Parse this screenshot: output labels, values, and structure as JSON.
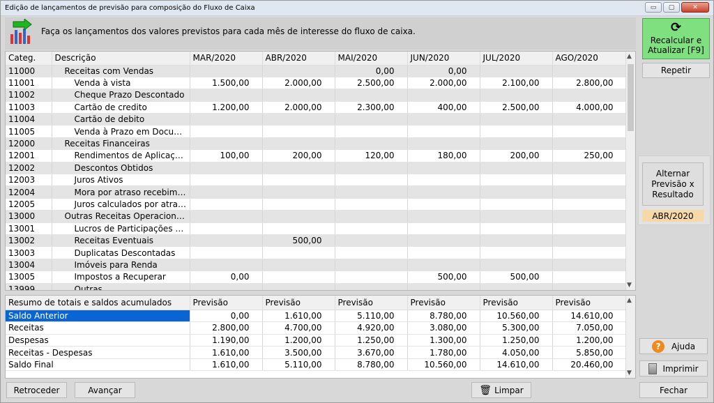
{
  "window": {
    "title": "Edição de lançamentos de previsão para composição do Fluxo de Caixa",
    "controls": {
      "minimize": "▭",
      "maximize": "▢",
      "close": "✕"
    }
  },
  "header": {
    "instruction": "Faça os lançamentos dos valores previstos para cada mês de interesse do fluxo de caixa."
  },
  "grid": {
    "columns": [
      "Categ.",
      "Descrição",
      "MAR/2020",
      "ABR/2020",
      "MAI/2020",
      "JUN/2020",
      "JUL/2020",
      "AGO/2020"
    ],
    "rows": [
      {
        "cat": "11000",
        "desc": "Receitas com Vendas",
        "level": 1,
        "group": true,
        "v": [
          "",
          "",
          "0,00",
          "0,00",
          "",
          ""
        ]
      },
      {
        "cat": "11001",
        "desc": "Venda à vista",
        "level": 2,
        "group": false,
        "v": [
          "1.500,00",
          "2.000,00",
          "2.500,00",
          "2.000,00",
          "2.100,00",
          "2.800,00"
        ]
      },
      {
        "cat": "11002",
        "desc": "Cheque Prazo Descontado",
        "level": 2,
        "group": true,
        "v": [
          "",
          "",
          "",
          "",
          "",
          ""
        ]
      },
      {
        "cat": "11003",
        "desc": "Cartão de credito",
        "level": 2,
        "group": false,
        "v": [
          "1.200,00",
          "2.000,00",
          "2.300,00",
          "400,00",
          "2.500,00",
          "4.000,00"
        ]
      },
      {
        "cat": "11004",
        "desc": "Cartão de debito",
        "level": 2,
        "group": true,
        "v": [
          "",
          "",
          "",
          "",
          "",
          ""
        ]
      },
      {
        "cat": "11005",
        "desc": "Venda à Prazo em Documentos",
        "level": 2,
        "group": false,
        "v": [
          "",
          "",
          "",
          "",
          "",
          ""
        ]
      },
      {
        "cat": "12000",
        "desc": "Receitas Financeiras",
        "level": 1,
        "group": true,
        "v": [
          "",
          "",
          "",
          "",
          "",
          ""
        ]
      },
      {
        "cat": "12001",
        "desc": "Rendimentos de Aplicações Financeiras",
        "level": 2,
        "group": false,
        "v": [
          "100,00",
          "200,00",
          "120,00",
          "180,00",
          "200,00",
          "250,00"
        ]
      },
      {
        "cat": "12002",
        "desc": "Descontos Obtidos",
        "level": 2,
        "group": true,
        "v": [
          "",
          "",
          "",
          "",
          "",
          ""
        ]
      },
      {
        "cat": "12003",
        "desc": "Juros Ativos",
        "level": 2,
        "group": false,
        "v": [
          "",
          "",
          "",
          "",
          "",
          ""
        ]
      },
      {
        "cat": "12004",
        "desc": "Mora por atraso recebimento",
        "level": 2,
        "group": true,
        "v": [
          "",
          "",
          "",
          "",
          "",
          ""
        ]
      },
      {
        "cat": "12005",
        "desc": "Juros calculados por atraso no pagamento",
        "level": 2,
        "group": false,
        "v": [
          "",
          "",
          "",
          "",
          "",
          ""
        ]
      },
      {
        "cat": "13000",
        "desc": "Outras Receitas Operacionais",
        "level": 1,
        "group": true,
        "v": [
          "",
          "",
          "",
          "",
          "",
          ""
        ]
      },
      {
        "cat": "13001",
        "desc": "Lucros de Participações em Outras Empresas",
        "level": 2,
        "group": false,
        "v": [
          "",
          "",
          "",
          "",
          "",
          ""
        ]
      },
      {
        "cat": "13002",
        "desc": "Receitas Eventuais",
        "level": 2,
        "group": true,
        "v": [
          "",
          "500,00",
          "",
          "",
          "",
          ""
        ]
      },
      {
        "cat": "13003",
        "desc": "Duplicatas Descontadas",
        "level": 2,
        "group": false,
        "v": [
          "",
          "",
          "",
          "",
          "",
          ""
        ]
      },
      {
        "cat": "13004",
        "desc": "Imóveis para Renda",
        "level": 2,
        "group": true,
        "v": [
          "",
          "",
          "",
          "",
          "",
          ""
        ]
      },
      {
        "cat": "13005",
        "desc": "Impostos a Recuperar",
        "level": 2,
        "group": false,
        "v": [
          "0,00",
          "",
          "",
          "500,00",
          "500,00",
          ""
        ]
      },
      {
        "cat": "13999",
        "desc": "Outras",
        "level": 2,
        "group": true,
        "v": [
          "",
          "",
          "",
          "",
          "",
          ""
        ]
      }
    ]
  },
  "summary": {
    "columns": [
      "Resumo de totais e saldos acumulados",
      "Previsão",
      "Previsão",
      "Previsão",
      "Previsão",
      "Previsão",
      "Previsão"
    ],
    "rows": [
      {
        "label": "Saldo Anterior",
        "selected": true,
        "v": [
          "0,00",
          "1.610,00",
          "5.110,00",
          "8.780,00",
          "10.560,00",
          "14.610,00"
        ]
      },
      {
        "label": "Receitas",
        "selected": false,
        "v": [
          "2.800,00",
          "4.700,00",
          "4.920,00",
          "3.080,00",
          "5.300,00",
          "7.050,00"
        ]
      },
      {
        "label": "Despesas",
        "selected": false,
        "v": [
          "1.190,00",
          "1.200,00",
          "1.250,00",
          "1.300,00",
          "1.250,00",
          "1.200,00"
        ]
      },
      {
        "label": "Receitas - Despesas",
        "selected": false,
        "v": [
          "1.610,00",
          "3.500,00",
          "3.670,00",
          "1.780,00",
          "4.050,00",
          "5.850,00"
        ]
      },
      {
        "label": "Saldo Final",
        "selected": false,
        "v": [
          "1.610,00",
          "5.110,00",
          "8.780,00",
          "10.560,00",
          "14.610,00",
          "20.460,00"
        ]
      }
    ]
  },
  "buttons": {
    "recalc_line1": "Recalcular e",
    "recalc_line2": "Atualizar [F9]",
    "repeat": "Repetir",
    "toggle_line1": "Alternar",
    "toggle_line2": "Previsão x",
    "toggle_line3": "Resultado",
    "period": "ABR/2020",
    "help": "Ajuda",
    "print": "Imprimir",
    "clear": "Limpar",
    "back": "Retroceder",
    "forward": "Avançar",
    "close": "Fechar"
  },
  "icons": {
    "refresh": "⟳",
    "help": "?",
    "trash": "🗑"
  },
  "colors": {
    "recalc_bg": "#7ee07e",
    "selected_row": "#0a64d4",
    "period_bg": "#f7d9a7",
    "help_icon": "#f08a1e"
  }
}
